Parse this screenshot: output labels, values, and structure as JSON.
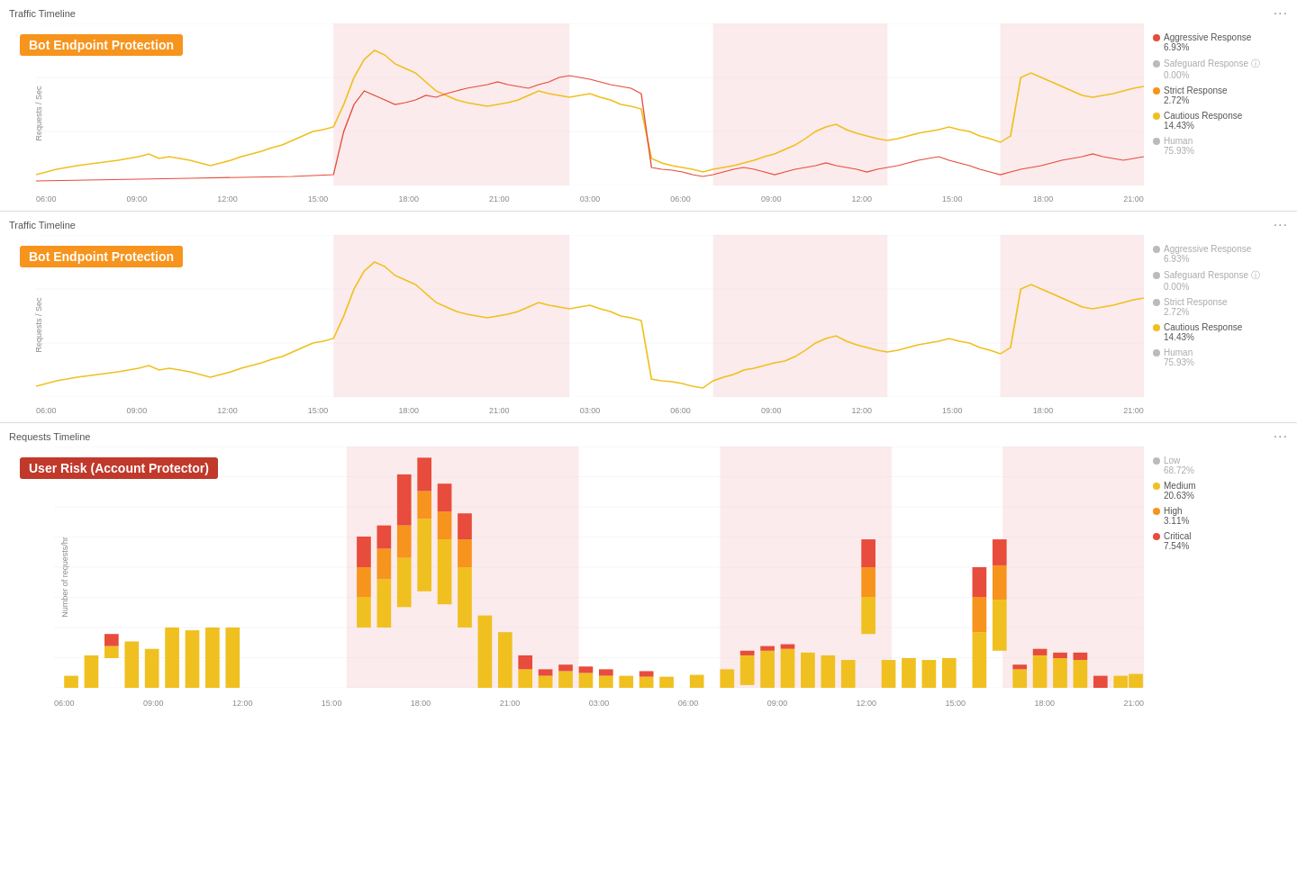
{
  "panels": [
    {
      "id": "panel1",
      "title": "Traffic Timeline",
      "chart_title": "Bot Endpoint Protection",
      "y_label": "Requests / Sec",
      "y_max": 3,
      "x_labels": [
        "06:00",
        "09:00",
        "12:00",
        "15:00",
        "18:00",
        "21:00",
        "03:00",
        "06:00",
        "09:00",
        "12:00",
        "15:00",
        "18:00",
        "21:00"
      ],
      "annotations": [
        "1",
        "2",
        "3"
      ],
      "legend": [
        {
          "label": "Aggressive Response",
          "pct": "6.93%",
          "color": "#e74c3c",
          "faded": false
        },
        {
          "label": "Safeguard Response",
          "pct": "0.00%",
          "color": "#bbb",
          "faded": true
        },
        {
          "label": "Strict Response",
          "pct": "2.72%",
          "color": "#f7941d",
          "faded": false
        },
        {
          "label": "Cautious Response",
          "pct": "14.43%",
          "color": "#f0c020",
          "faded": false
        },
        {
          "label": "Human",
          "pct": "75.93%",
          "color": "#bbb",
          "faded": true
        }
      ]
    },
    {
      "id": "panel2",
      "title": "Traffic Timeline",
      "chart_title": "Bot Endpoint Protection",
      "y_label": "Requests / Sec",
      "y_max": 3,
      "x_labels": [
        "06:00",
        "09:00",
        "12:00",
        "15:00",
        "18:00",
        "21:00",
        "03:00",
        "06:00",
        "09:00",
        "12:00",
        "15:00",
        "18:00",
        "21:00"
      ],
      "legend": [
        {
          "label": "Aggressive Response",
          "pct": "6.93%",
          "color": "#bbb",
          "faded": true
        },
        {
          "label": "Safeguard Response",
          "pct": "0.00%",
          "color": "#bbb",
          "faded": true
        },
        {
          "label": "Strict Response",
          "pct": "2.72%",
          "color": "#bbb",
          "faded": true
        },
        {
          "label": "Cautious Response",
          "pct": "14.43%",
          "color": "#f0c020",
          "faded": false
        },
        {
          "label": "Human",
          "pct": "75.93%",
          "color": "#bbb",
          "faded": true
        }
      ]
    },
    {
      "id": "panel3",
      "title": "Requests Timeline",
      "chart_title": "User Risk (Account Protector)",
      "y_label": "Number of requests/hr",
      "x_labels": [
        "06:00",
        "09:00",
        "12:00",
        "15:00",
        "18:00",
        "21:00",
        "03:00",
        "06:00",
        "09:00",
        "12:00",
        "15:00",
        "18:00",
        "21:00"
      ],
      "legend": [
        {
          "label": "Low",
          "pct": "68.72%",
          "color": "#bbb",
          "faded": true
        },
        {
          "label": "Medium",
          "pct": "20.63%",
          "color": "#f0c020",
          "faded": false
        },
        {
          "label": "High",
          "pct": "3.11%",
          "color": "#f7941d",
          "faded": false
        },
        {
          "label": "Critical",
          "pct": "7.54%",
          "color": "#e74c3c",
          "faded": false
        }
      ]
    }
  ]
}
